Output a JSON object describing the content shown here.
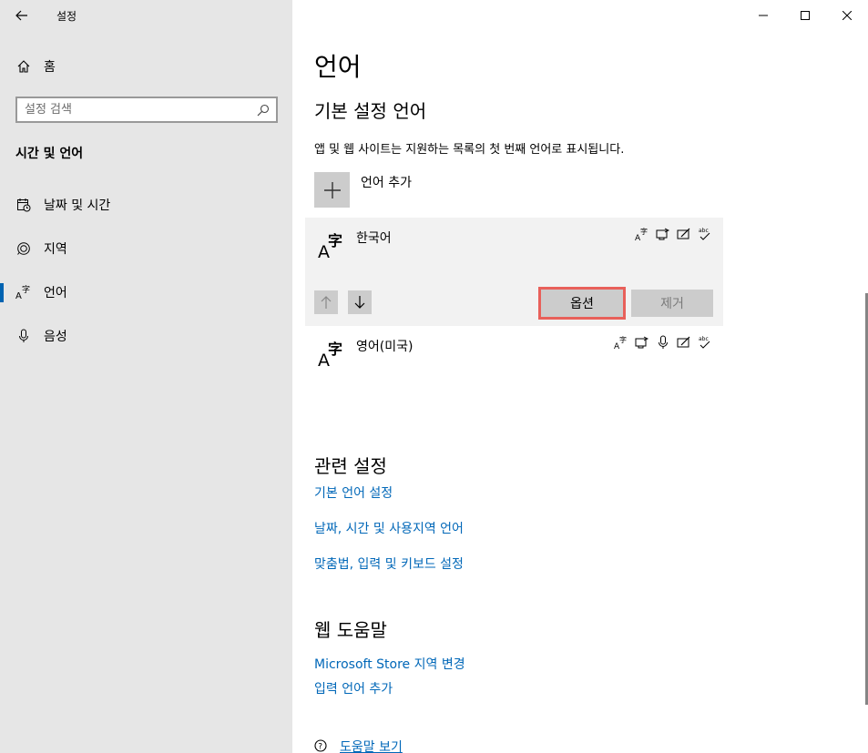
{
  "window": {
    "title": "설정"
  },
  "sidebar": {
    "home_label": "홈",
    "search_placeholder": "설정 검색",
    "section_title": "시간 및 언어",
    "items": [
      {
        "label": "날짜 및 시간",
        "icon": "calendar-clock-icon"
      },
      {
        "label": "지역",
        "icon": "globe-icon"
      },
      {
        "label": "언어",
        "icon": "language-icon",
        "active": true
      },
      {
        "label": "음성",
        "icon": "microphone-icon"
      }
    ]
  },
  "main": {
    "title": "언어",
    "preferred": {
      "heading": "기본 설정 언어",
      "description": "앱 및 웹 사이트는 지원하는 목록의 첫 번째 언어로 표시됩니다.",
      "add_label": "언어 추가",
      "languages": [
        {
          "name": "한국어",
          "selected": true
        },
        {
          "name": "영어(미국)"
        }
      ],
      "options_label": "옵션",
      "remove_label": "제거"
    },
    "related": {
      "heading": "관련 설정",
      "links": [
        "기본 언어 설정",
        "날짜, 시간 및 사용지역 언어",
        "맞춤법, 입력 및 키보드 설정"
      ]
    },
    "web_help": {
      "heading": "웹 도움말",
      "links": [
        "Microsoft Store 지역 변경",
        "입력 언어 추가"
      ]
    },
    "help_link": "도움말 보기"
  },
  "colors": {
    "accent": "#0063b1",
    "link": "#0067b8",
    "highlight": "#e8605a"
  }
}
